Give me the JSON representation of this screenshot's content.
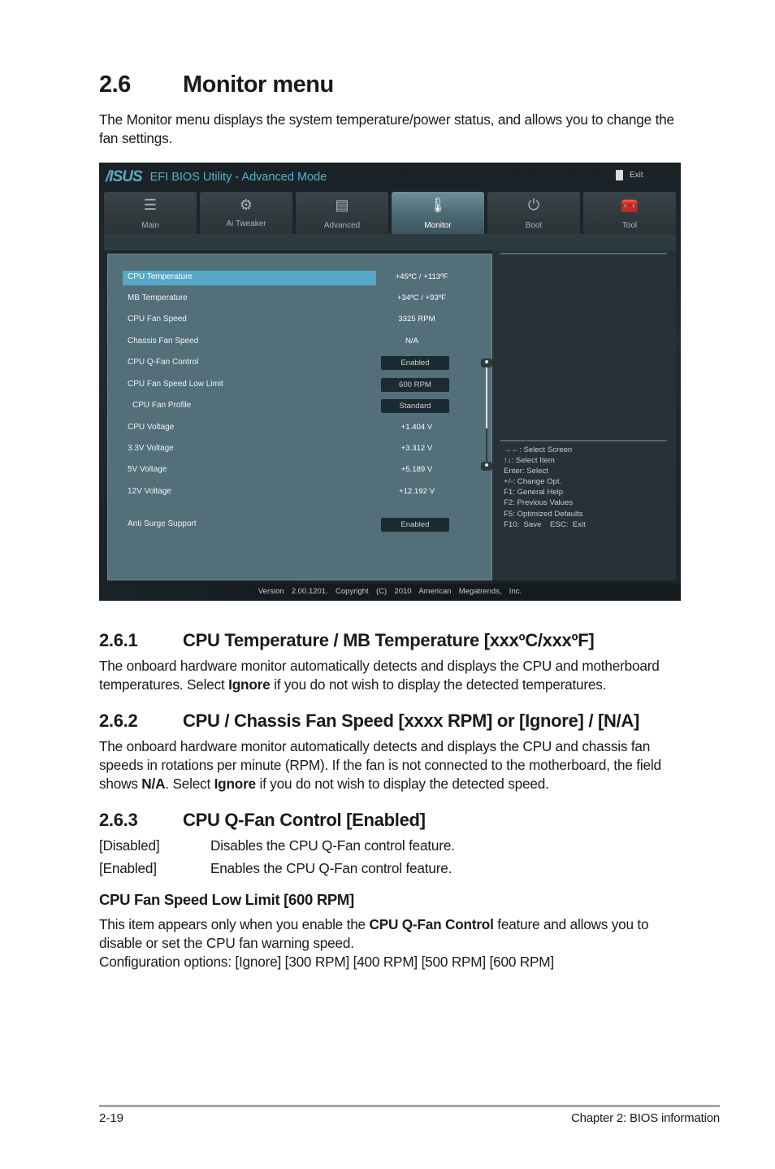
{
  "section": {
    "number": "2.6",
    "title": "Monitor menu",
    "intro": "The Monitor menu displays the system temperature/power status, and allows you to change the fan settings."
  },
  "bios": {
    "brand": "/ISUS",
    "title": "EFI BIOS Utility - Advanced Mode",
    "exit_label": "Exit",
    "tabs": [
      {
        "label": "Main",
        "icon": "list-icon",
        "glyph": "☰",
        "active": false
      },
      {
        "label": "Ai  Tweaker",
        "icon": "tweaker-icon",
        "glyph": "⚙",
        "active": false
      },
      {
        "label": "Advanced",
        "icon": "advanced-icon",
        "glyph": "▤",
        "active": false
      },
      {
        "label": "Monitor",
        "icon": "monitor-icon",
        "glyph": "🌡",
        "active": true
      },
      {
        "label": "Boot",
        "icon": "power-icon",
        "glyph": "⏻",
        "active": false
      },
      {
        "label": "Tool",
        "icon": "toolbox-icon",
        "glyph": "🧰",
        "active": false
      }
    ],
    "items": [
      {
        "label": "CPU Temperature",
        "value": "+45ºC / +113ºF",
        "type": "text",
        "selected": true
      },
      {
        "label": "MB Temperature",
        "value": "+34ºC / +93ºF",
        "type": "text"
      },
      {
        "label": "CPU Fan Speed",
        "value": "3325 RPM",
        "type": "text"
      },
      {
        "label": "Chassis Fan Speed",
        "value": "N/A",
        "type": "text"
      },
      {
        "label": "CPU Q-Fan Control",
        "value": "Enabled",
        "type": "select"
      },
      {
        "label": "CPU Fan Speed Low Limit",
        "value": "600 RPM",
        "type": "select"
      },
      {
        "label": "CPU Fan Profile",
        "value": "Standard",
        "type": "select",
        "indent": true
      },
      {
        "label": "CPU Voltage",
        "value": "+1.404 V",
        "type": "text"
      },
      {
        "label": "3.3V Voltage",
        "value": "+3.312 V",
        "type": "text"
      },
      {
        "label": "5V Voltage",
        "value": "+5.189 V",
        "type": "text"
      },
      {
        "label": "12V Voltage",
        "value": "+12.192 V",
        "type": "text"
      },
      {
        "label": "Anti Surge Support",
        "value": "Enabled",
        "type": "select"
      }
    ],
    "help": [
      "→←:  Select Screen",
      "↑↓:  Select Item",
      "Enter:  Select",
      "+/-:  Change Opt.",
      "F1:  General Help",
      "F2:  Previous Values",
      "F5:  Optimized Defaults",
      "F10:  Save    ESC:  Exit"
    ],
    "version": "Version  2.00.1201.  Copyright  (C)  2010  American  Megatrends,  Inc."
  },
  "s261": {
    "number": "2.6.1",
    "title": "CPU Temperature / MB Temperature [xxxºC/xxxºF]",
    "body_a": "The onboard hardware monitor automatically detects and displays the CPU and motherboard temperatures. Select ",
    "body_bold": "Ignore",
    "body_b": " if you do not wish to display the detected temperatures."
  },
  "s262": {
    "number": "2.6.2",
    "title": "CPU / Chassis Fan Speed [xxxx RPM] or [Ignore] / [N/A]",
    "body_a": "The onboard hardware monitor automatically detects and displays the CPU and chassis fan speeds in rotations per minute (RPM). If the fan is not connected to the motherboard, the field shows ",
    "body_bold1": "N/A",
    "body_b": ". Select ",
    "body_bold2": "Ignore",
    "body_c": " if you do not wish to display the detected speed."
  },
  "s263": {
    "number": "2.6.3",
    "title": "CPU Q-Fan Control [Enabled]",
    "options": [
      {
        "key": "[Disabled]",
        "desc": "Disables the CPU Q-Fan control feature."
      },
      {
        "key": "[Enabled]",
        "desc": "Enables the CPU Q-Fan control feature."
      }
    ]
  },
  "lowlimit": {
    "title": "CPU Fan Speed Low Limit [600 RPM]",
    "body_a": "This item appears only when you enable the ",
    "body_bold": "CPU Q-Fan Control",
    "body_b": " feature and allows you to disable or set the CPU fan warning speed.",
    "config": "Configuration options: [Ignore] [300 RPM] [400 RPM] [500 RPM] [600 RPM]"
  },
  "footer": {
    "page": "2-19",
    "chapter": "Chapter 2: BIOS information"
  }
}
